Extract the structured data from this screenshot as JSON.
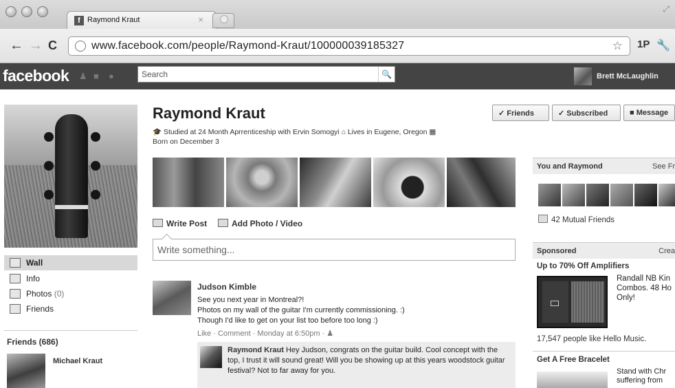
{
  "browser": {
    "tab_title": "Raymond Kraut",
    "tab_favicon": "f",
    "tab_close": "×",
    "back": "←",
    "forward": "→",
    "reload": "C",
    "url": "www.facebook.com/people/Raymond-Kraut/100000039185327",
    "bookmark_star": "☆",
    "extension_label": "1P",
    "wrench": "🔧"
  },
  "fb": {
    "logo": "facebook",
    "search_placeholder": "Search",
    "account_name": "Brett McLaughlin"
  },
  "left": {
    "nav": [
      {
        "label": "Wall",
        "count": ""
      },
      {
        "label": "Info",
        "count": ""
      },
      {
        "label": "Photos",
        "count": "(0)"
      },
      {
        "label": "Friends",
        "count": ""
      }
    ],
    "friends_heading": "Friends (686)",
    "friend_name": "Michael Kraut"
  },
  "profile": {
    "name": "Raymond Kraut",
    "buttons": {
      "friends": "✓ Friends",
      "subscribed": "✓ Subscribed",
      "message": "■ Message"
    },
    "bio_line1": "Studied at 24 Month Aprrenticeship with Ervin Somogyi",
    "bio_lives": "Lives in Eugene, Oregon",
    "bio_line2": "Born on December 3"
  },
  "composer": {
    "write_post": "Write Post",
    "add_photo": "Add Photo / Video",
    "placeholder": "Write something..."
  },
  "post": {
    "author": "Judson Kimble",
    "lines": [
      "See you next year in Montreal?!",
      "Photos on my wall of the guitar I'm currently commissioning. :)",
      "Though I'd like to get on your list too before too long :)"
    ],
    "meta": "Like · Comment · Monday at 6:50pm · ",
    "comment_author": "Raymond Kraut",
    "comment_text": "Hey Judson, congrats on the guitar build. Cool concept with the top, I trust it will sound great! Will you be showing up at this years woodstock guitar festival? Not to far away for you."
  },
  "right": {
    "you_and": "You and Raymond",
    "see_friendship": "See Fr",
    "mutual": "42 Mutual Friends",
    "sponsored": "Sponsored",
    "create_ad": "Crea",
    "ad1_title": "Up to 70% Off Amplifiers",
    "ad1_text": [
      "Randall NB Kin",
      "Combos. 48 Ho",
      "Only!"
    ],
    "ad1_likes": "17,547 people like Hello Music.",
    "ad2_title": "Get A Free Bracelet",
    "ad2_text": [
      "Stand with Chr",
      "suffering from"
    ]
  }
}
